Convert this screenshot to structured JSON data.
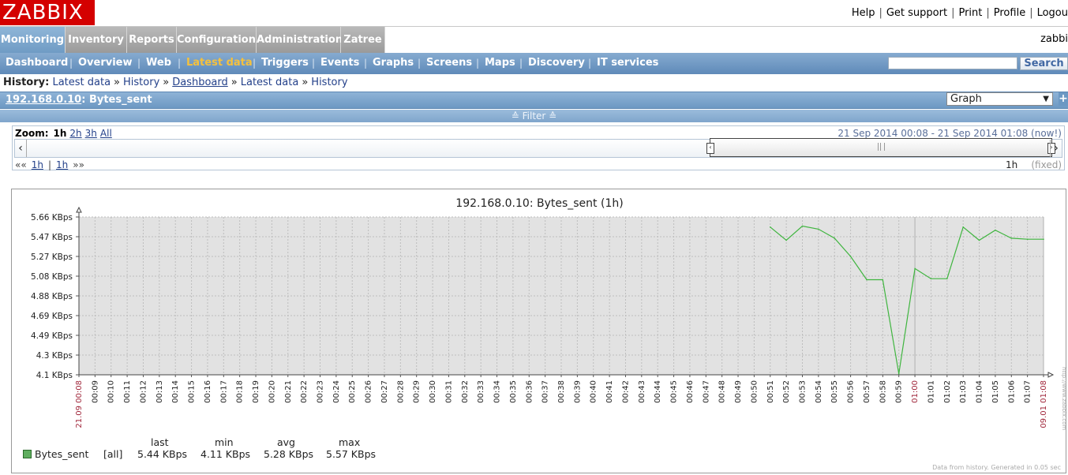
{
  "header": {
    "logo": "ZABBIX",
    "links": [
      "Help",
      "Get support",
      "Print",
      "Profile",
      "Logou"
    ],
    "username": "zabbi"
  },
  "main_menu": [
    "Monitoring",
    "Inventory",
    "Reports",
    "Configuration",
    "Administration",
    "Zatree"
  ],
  "sub_menu": [
    "Dashboard",
    "Overview",
    "Web",
    "Latest data",
    "Triggers",
    "Events",
    "Graphs",
    "Screens",
    "Maps",
    "Discovery",
    "IT services"
  ],
  "search": {
    "button": "Search"
  },
  "breadcrumb": {
    "label": "History:",
    "items": [
      "Latest data",
      "History",
      "Dashboard",
      "Latest data",
      "History"
    ]
  },
  "title": {
    "host": "192.168.0.10",
    "rest": ": Bytes_sent"
  },
  "graph_select": "Graph",
  "filter_label": "≙ Filter ≙",
  "zoom": {
    "label": "Zoom:",
    "current": "1h",
    "options": [
      "2h",
      "3h",
      "All"
    ],
    "period_text": "21 Sep 2014 00:08  -  21 Sep 2014 01:08 (now!)",
    "nav_left": "««",
    "nav_right": "»»",
    "nav_step1": "1h",
    "nav_sep": "|",
    "nav_step2": "1h",
    "period_length": "1h",
    "fixed": "(fixed)"
  },
  "chart_data": {
    "type": "line",
    "title": "192.168.0.10: Bytes_sent (1h)",
    "y_ticks": [
      "5.66 KBps",
      "5.47 KBps",
      "5.27 KBps",
      "5.08 KBps",
      "4.88 KBps",
      "4.69 KBps",
      "4.49 KBps",
      "4.3 KBps",
      "4.1 KBps"
    ],
    "ylim": [
      4.1,
      5.66
    ],
    "y_unit": "KBps",
    "x_labels": [
      "21.09 00:08",
      "00:09",
      "00:10",
      "00:11",
      "00:12",
      "00:13",
      "00:14",
      "00:15",
      "00:16",
      "00:17",
      "00:18",
      "00:19",
      "00:20",
      "00:21",
      "00:22",
      "00:23",
      "00:24",
      "00:25",
      "00:26",
      "00:27",
      "00:28",
      "00:29",
      "00:30",
      "00:31",
      "00:32",
      "00:33",
      "00:34",
      "00:35",
      "00:36",
      "00:37",
      "00:38",
      "00:39",
      "00:40",
      "00:41",
      "00:42",
      "00:43",
      "00:44",
      "00:45",
      "00:46",
      "00:47",
      "00:48",
      "00:49",
      "00:50",
      "00:51",
      "00:52",
      "00:53",
      "00:54",
      "00:55",
      "00:56",
      "00:57",
      "00:58",
      "00:59",
      "01:00",
      "01:01",
      "01:02",
      "01:03",
      "01:04",
      "01:05",
      "01:06",
      "01:07",
      "09.01 01:08"
    ],
    "highlight_labels": [
      "21.09 00:08",
      "01:00",
      "09.01 01:08"
    ],
    "highlight_color": "#a0263a",
    "grid": true,
    "series": [
      {
        "name": "Bytes_sent",
        "color": "#3fb53f",
        "x": [
          "00:51",
          "00:52",
          "00:53",
          "00:54",
          "00:55",
          "00:56",
          "00:57",
          "00:58",
          "00:59",
          "01:00",
          "01:01",
          "01:02",
          "01:03",
          "01:04",
          "01:05",
          "01:06",
          "01:07",
          "01:08"
        ],
        "values": [
          5.56,
          5.43,
          5.57,
          5.54,
          5.45,
          5.27,
          5.04,
          5.04,
          4.11,
          5.15,
          5.05,
          5.05,
          5.56,
          5.43,
          5.53,
          5.45,
          5.44,
          5.44
        ]
      }
    ],
    "legend": {
      "headers": [
        "last",
        "min",
        "avg",
        "max"
      ],
      "item": {
        "name": "Bytes_sent",
        "func": "[all]",
        "last": "5.44 KBps",
        "min": "4.11 KBps",
        "avg": "5.28 KBps",
        "max": "5.57 KBps"
      }
    },
    "footer": "Data from history. Generated in 0.05 sec",
    "side_label": "http://www.zabbix.com"
  }
}
